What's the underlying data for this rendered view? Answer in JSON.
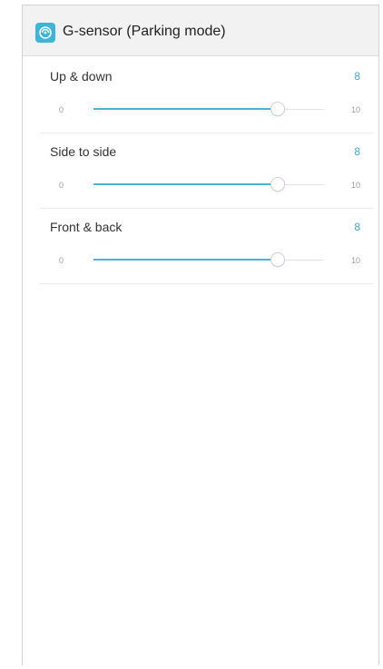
{
  "header": {
    "title": "G-sensor (Parking mode)",
    "icon": "g-sensor-app-icon"
  },
  "colors": {
    "accent": "#3aa9d4",
    "header_bg": "#f2f2f2"
  },
  "settings": [
    {
      "label": "Up & down",
      "value": "8",
      "min": "0",
      "max": "10",
      "level": 0.8
    },
    {
      "label": "Side to side",
      "value": "8",
      "min": "0",
      "max": "10",
      "level": 0.8
    },
    {
      "label": "Front & back",
      "value": "8",
      "min": "0",
      "max": "10",
      "level": 0.8
    }
  ]
}
